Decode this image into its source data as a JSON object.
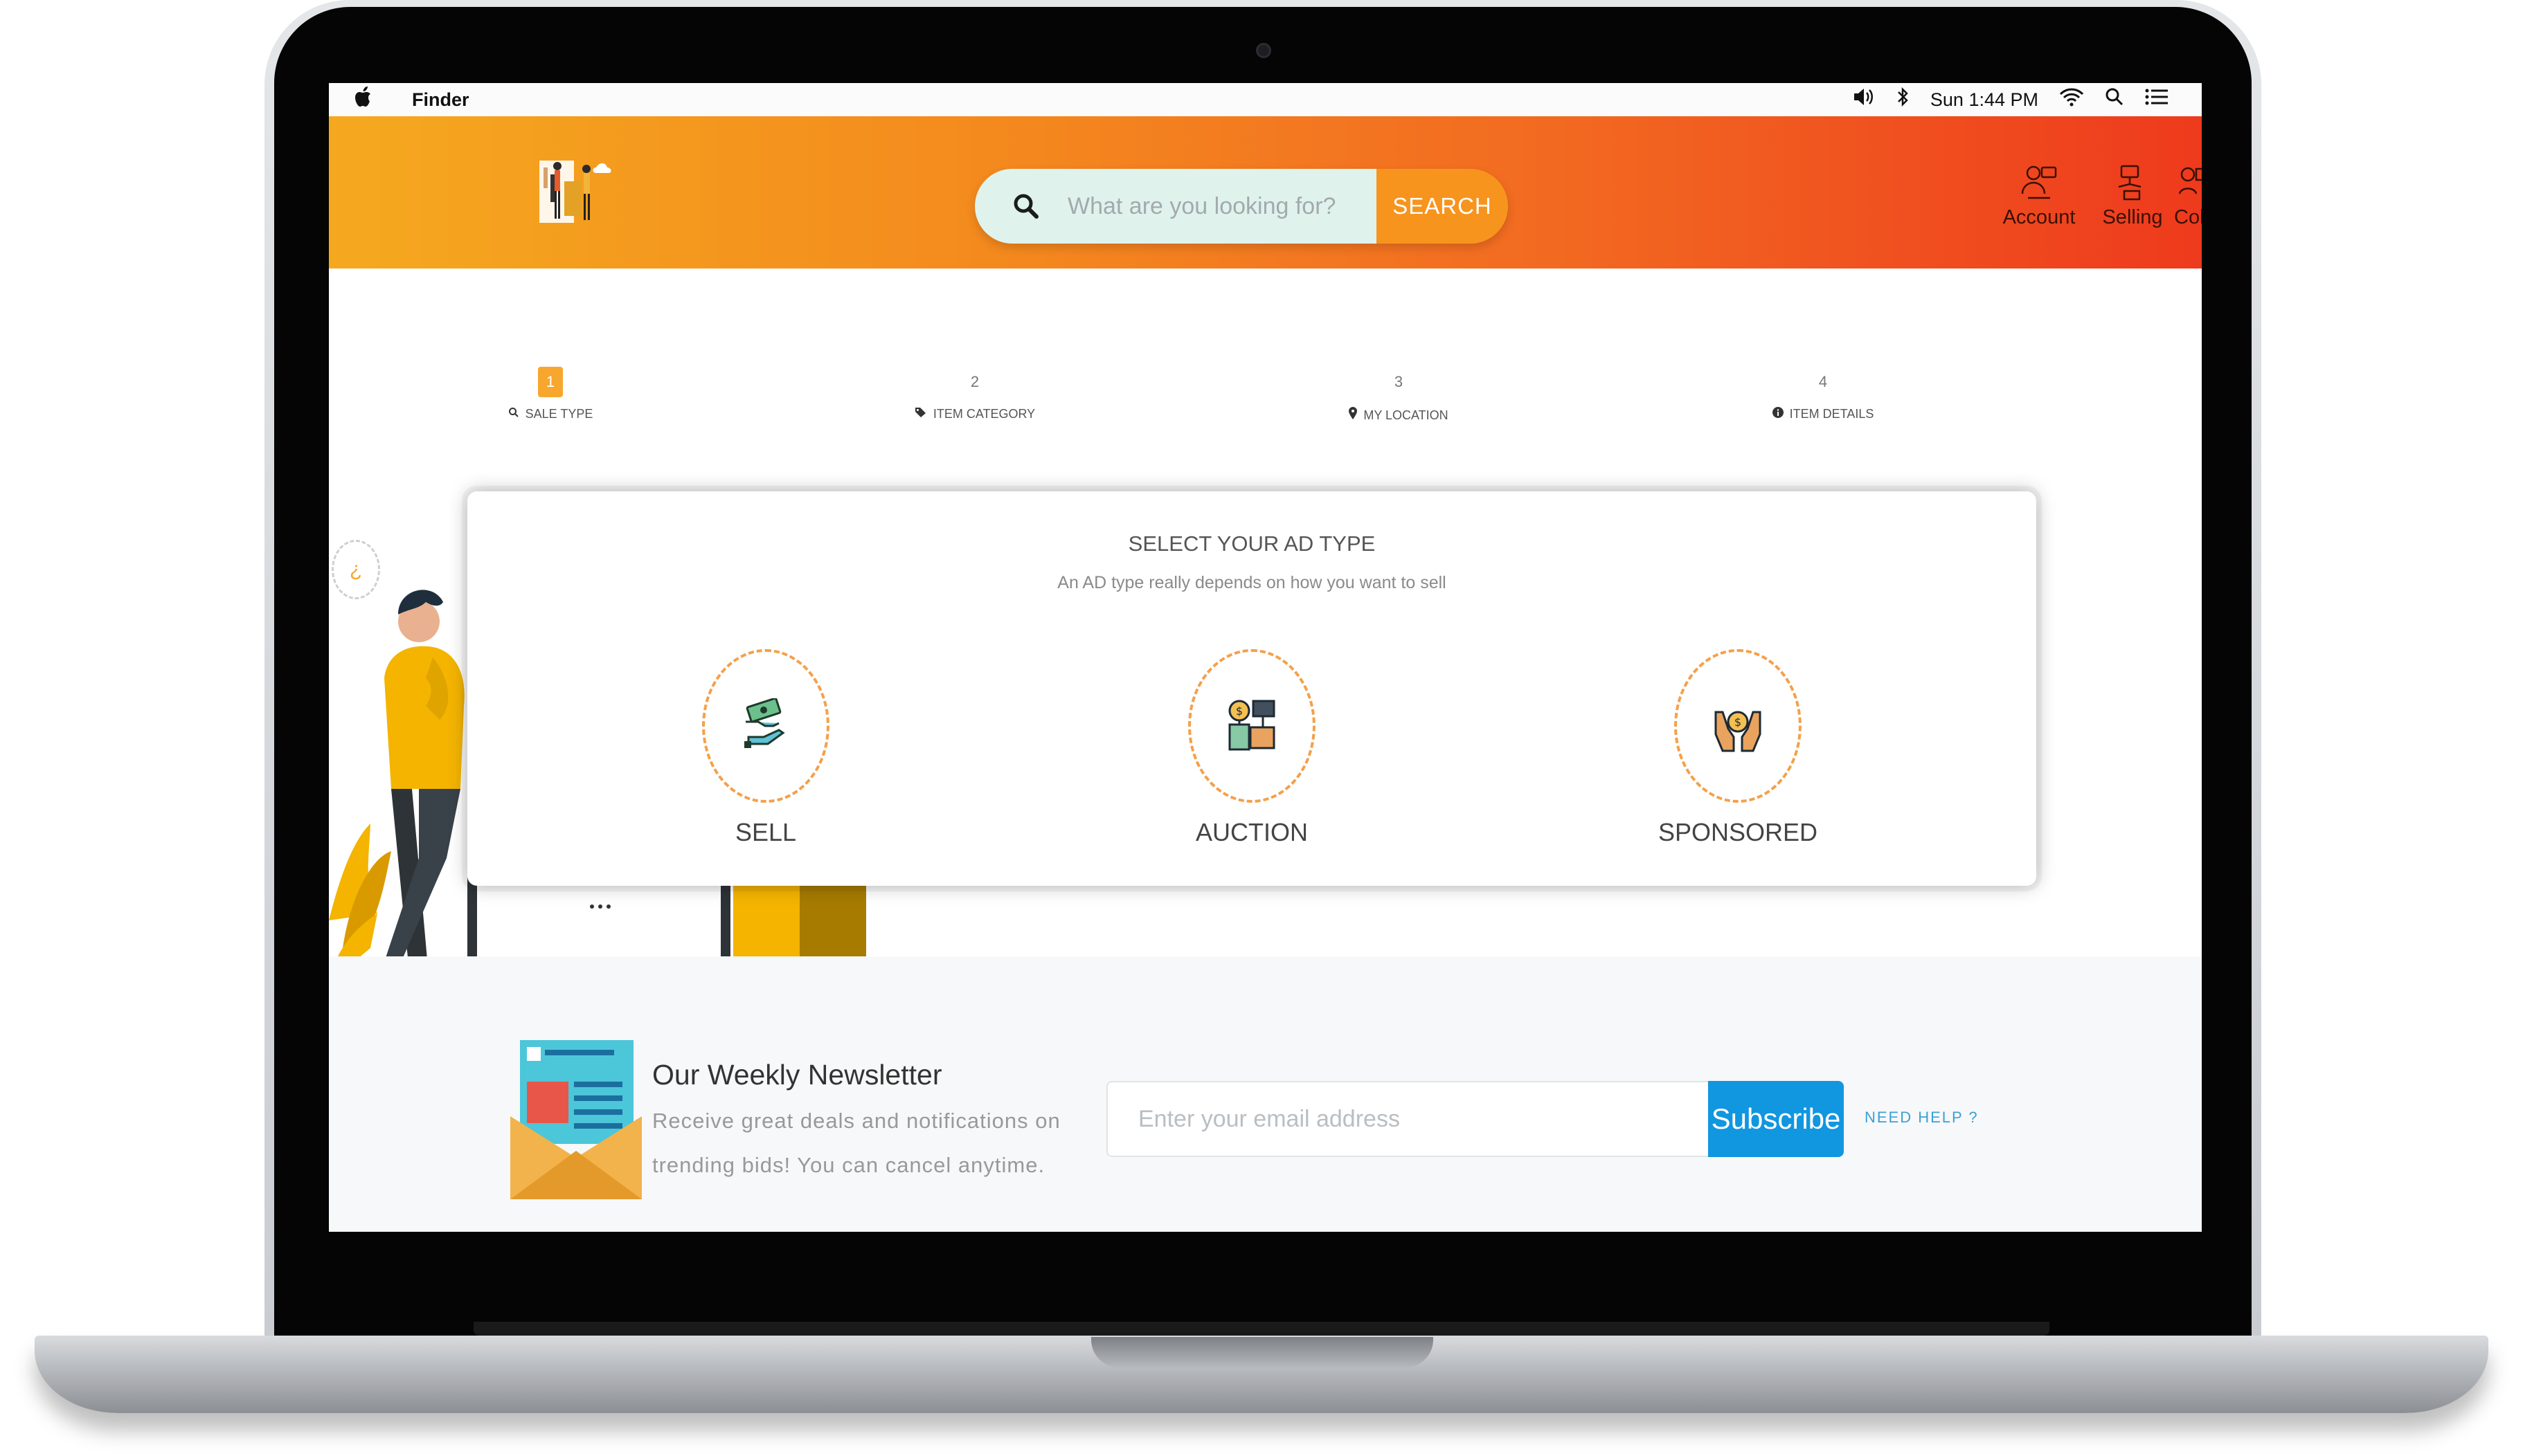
{
  "menubar": {
    "app_name": "Finder",
    "clock": "Sun 1:44 PM"
  },
  "header": {
    "search_placeholder": "What are you looking for?",
    "search_button": "SEARCH",
    "nav": [
      {
        "label": "Account"
      },
      {
        "label": "Selling"
      },
      {
        "label": "Collecti"
      }
    ]
  },
  "steps": [
    {
      "number": "1",
      "label": "SALE TYPE",
      "icon": "search-icon"
    },
    {
      "number": "2",
      "label": "ITEM CATEGORY",
      "icon": "tag-icon"
    },
    {
      "number": "3",
      "label": "MY LOCATION",
      "icon": "map-pin-icon"
    },
    {
      "number": "4",
      "label": "ITEM DETAILS",
      "icon": "info-icon"
    }
  ],
  "card": {
    "title": "SELECT YOUR AD TYPE",
    "subtitle": "An AD type really depends on how you want to sell",
    "options": [
      {
        "label": "SELL",
        "icon": "money-exchange-icon"
      },
      {
        "label": "AUCTION",
        "icon": "auction-icon"
      },
      {
        "label": "SPONSORED",
        "icon": "sponsor-hands-icon"
      }
    ]
  },
  "newsletter": {
    "title": "Our Weekly Newsletter",
    "description": "Receive great deals and notifications on trending bids! You can cancel anytime.",
    "email_placeholder": "Enter your email address",
    "subscribe": "Subscribe",
    "need_help": "NEED HELP ?"
  },
  "colors": {
    "header_start": "#f5a91f",
    "header_end": "#ee3a1d",
    "accent_orange": "#f7941d",
    "subscribe_blue": "#1196e0"
  }
}
